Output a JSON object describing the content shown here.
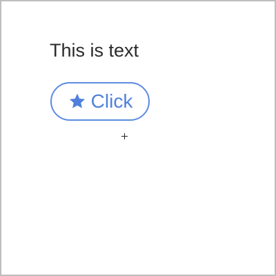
{
  "page": {
    "text": "This is text"
  },
  "button": {
    "label": "Click",
    "icon": "star-icon",
    "accent_color": "#4f80dd",
    "border_color": "#5b8be0"
  },
  "cursor": {
    "icon": "crosshair-cursor-icon"
  }
}
